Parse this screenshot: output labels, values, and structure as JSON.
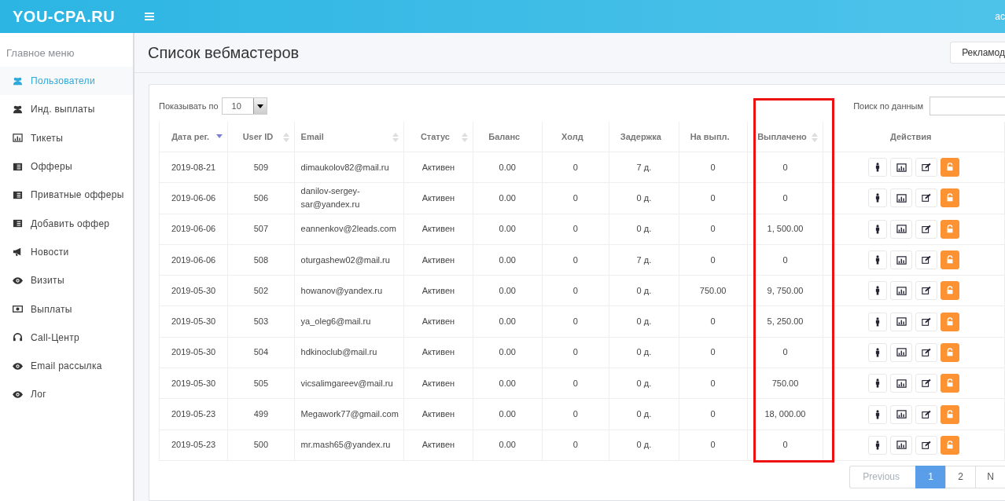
{
  "topbar": {
    "logo": "YOU-CPA.RU",
    "user": "ac"
  },
  "sidebar": {
    "heading": "Главное меню",
    "items": [
      {
        "label": "Пользователи",
        "selected": true
      },
      {
        "label": "Инд. выплаты",
        "selected": false
      },
      {
        "label": "Тикеты",
        "selected": false
      },
      {
        "label": "Офферы",
        "selected": false
      },
      {
        "label": "Приватные офферы",
        "selected": false
      },
      {
        "label": "Добавить оффер",
        "selected": false
      },
      {
        "label": "Новости",
        "selected": false
      },
      {
        "label": "Визиты",
        "selected": false
      },
      {
        "label": "Выплаты",
        "selected": false
      },
      {
        "label": "Call-Центр",
        "selected": false
      },
      {
        "label": "Email рассылка",
        "selected": false
      },
      {
        "label": "Лог",
        "selected": false
      }
    ]
  },
  "page": {
    "title": "Список вебмастеров",
    "button": "Рекламод"
  },
  "controls": {
    "length_label": "Показывать по",
    "length_value": "10",
    "search_label": "Поиск по данным"
  },
  "table": {
    "columns": [
      {
        "label": "Дата рег.",
        "sortable": true,
        "sorted": true,
        "highlighted": false
      },
      {
        "label": "User ID",
        "sortable": true,
        "sorted": false,
        "highlighted": false
      },
      {
        "label": "Email",
        "sortable": true,
        "sorted": false,
        "highlighted": false
      },
      {
        "label": "Статус",
        "sortable": true,
        "sorted": false,
        "highlighted": false
      },
      {
        "label": "Баланс",
        "sortable": false,
        "sorted": false,
        "highlighted": false
      },
      {
        "label": "Холд",
        "sortable": false,
        "sorted": false,
        "highlighted": false
      },
      {
        "label": "Задержка",
        "sortable": false,
        "sorted": false,
        "highlighted": false
      },
      {
        "label": "На выпл.",
        "sortable": false,
        "sorted": false,
        "highlighted": false
      },
      {
        "label": "Выплачено",
        "sortable": true,
        "sorted": false,
        "highlighted": true
      },
      {
        "label": "Действия",
        "sortable": false,
        "sorted": false,
        "highlighted": false
      }
    ],
    "rows": [
      {
        "cells": [
          "2019-08-21",
          "509",
          "dimaukolov82@mail.ru",
          "Активен",
          "0.00",
          "0",
          "7 д.",
          "0",
          "0"
        ]
      },
      {
        "cells": [
          "2019-06-06",
          "506",
          "danilov-sergey-sar@yandex.ru",
          "Активен",
          "0.00",
          "0",
          "0 д.",
          "0",
          "0"
        ]
      },
      {
        "cells": [
          "2019-06-06",
          "507",
          "eannenkov@2leads.com",
          "Активен",
          "0.00",
          "0",
          "0 д.",
          "0",
          "1, 500.00"
        ]
      },
      {
        "cells": [
          "2019-06-06",
          "508",
          "oturgashew02@mail.ru",
          "Активен",
          "0.00",
          "0",
          "7 д.",
          "0",
          "0"
        ]
      },
      {
        "cells": [
          "2019-05-30",
          "502",
          "howanov@yandex.ru",
          "Активен",
          "0.00",
          "0",
          "0 д.",
          "750.00",
          "9, 750.00"
        ]
      },
      {
        "cells": [
          "2019-05-30",
          "503",
          "ya_oleg6@mail.ru",
          "Активен",
          "0.00",
          "0",
          "0 д.",
          "0",
          "5, 250.00"
        ]
      },
      {
        "cells": [
          "2019-05-30",
          "504",
          "hdkinoclub@mail.ru",
          "Активен",
          "0.00",
          "0",
          "0 д.",
          "0",
          "0"
        ]
      },
      {
        "cells": [
          "2019-05-30",
          "505",
          "vicsalimgareev@mail.ru",
          "Активен",
          "0.00",
          "0",
          "0 д.",
          "0",
          "750.00"
        ]
      },
      {
        "cells": [
          "2019-05-23",
          "499",
          "Megawork77@gmail.com",
          "Активен",
          "0.00",
          "0",
          "0 д.",
          "0",
          "18, 000.00"
        ]
      },
      {
        "cells": [
          "2019-05-23",
          "500",
          "mr.mash65@yandex.ru",
          "Активен",
          "0.00",
          "0",
          "0 д.",
          "0",
          "0"
        ]
      }
    ]
  },
  "pagination": [
    {
      "label": "Previous",
      "selected": false,
      "disabled": true
    },
    {
      "label": "1",
      "selected": true,
      "disabled": false
    },
    {
      "label": "2",
      "selected": false,
      "disabled": false
    },
    {
      "label": "N",
      "selected": false,
      "disabled": false
    }
  ]
}
